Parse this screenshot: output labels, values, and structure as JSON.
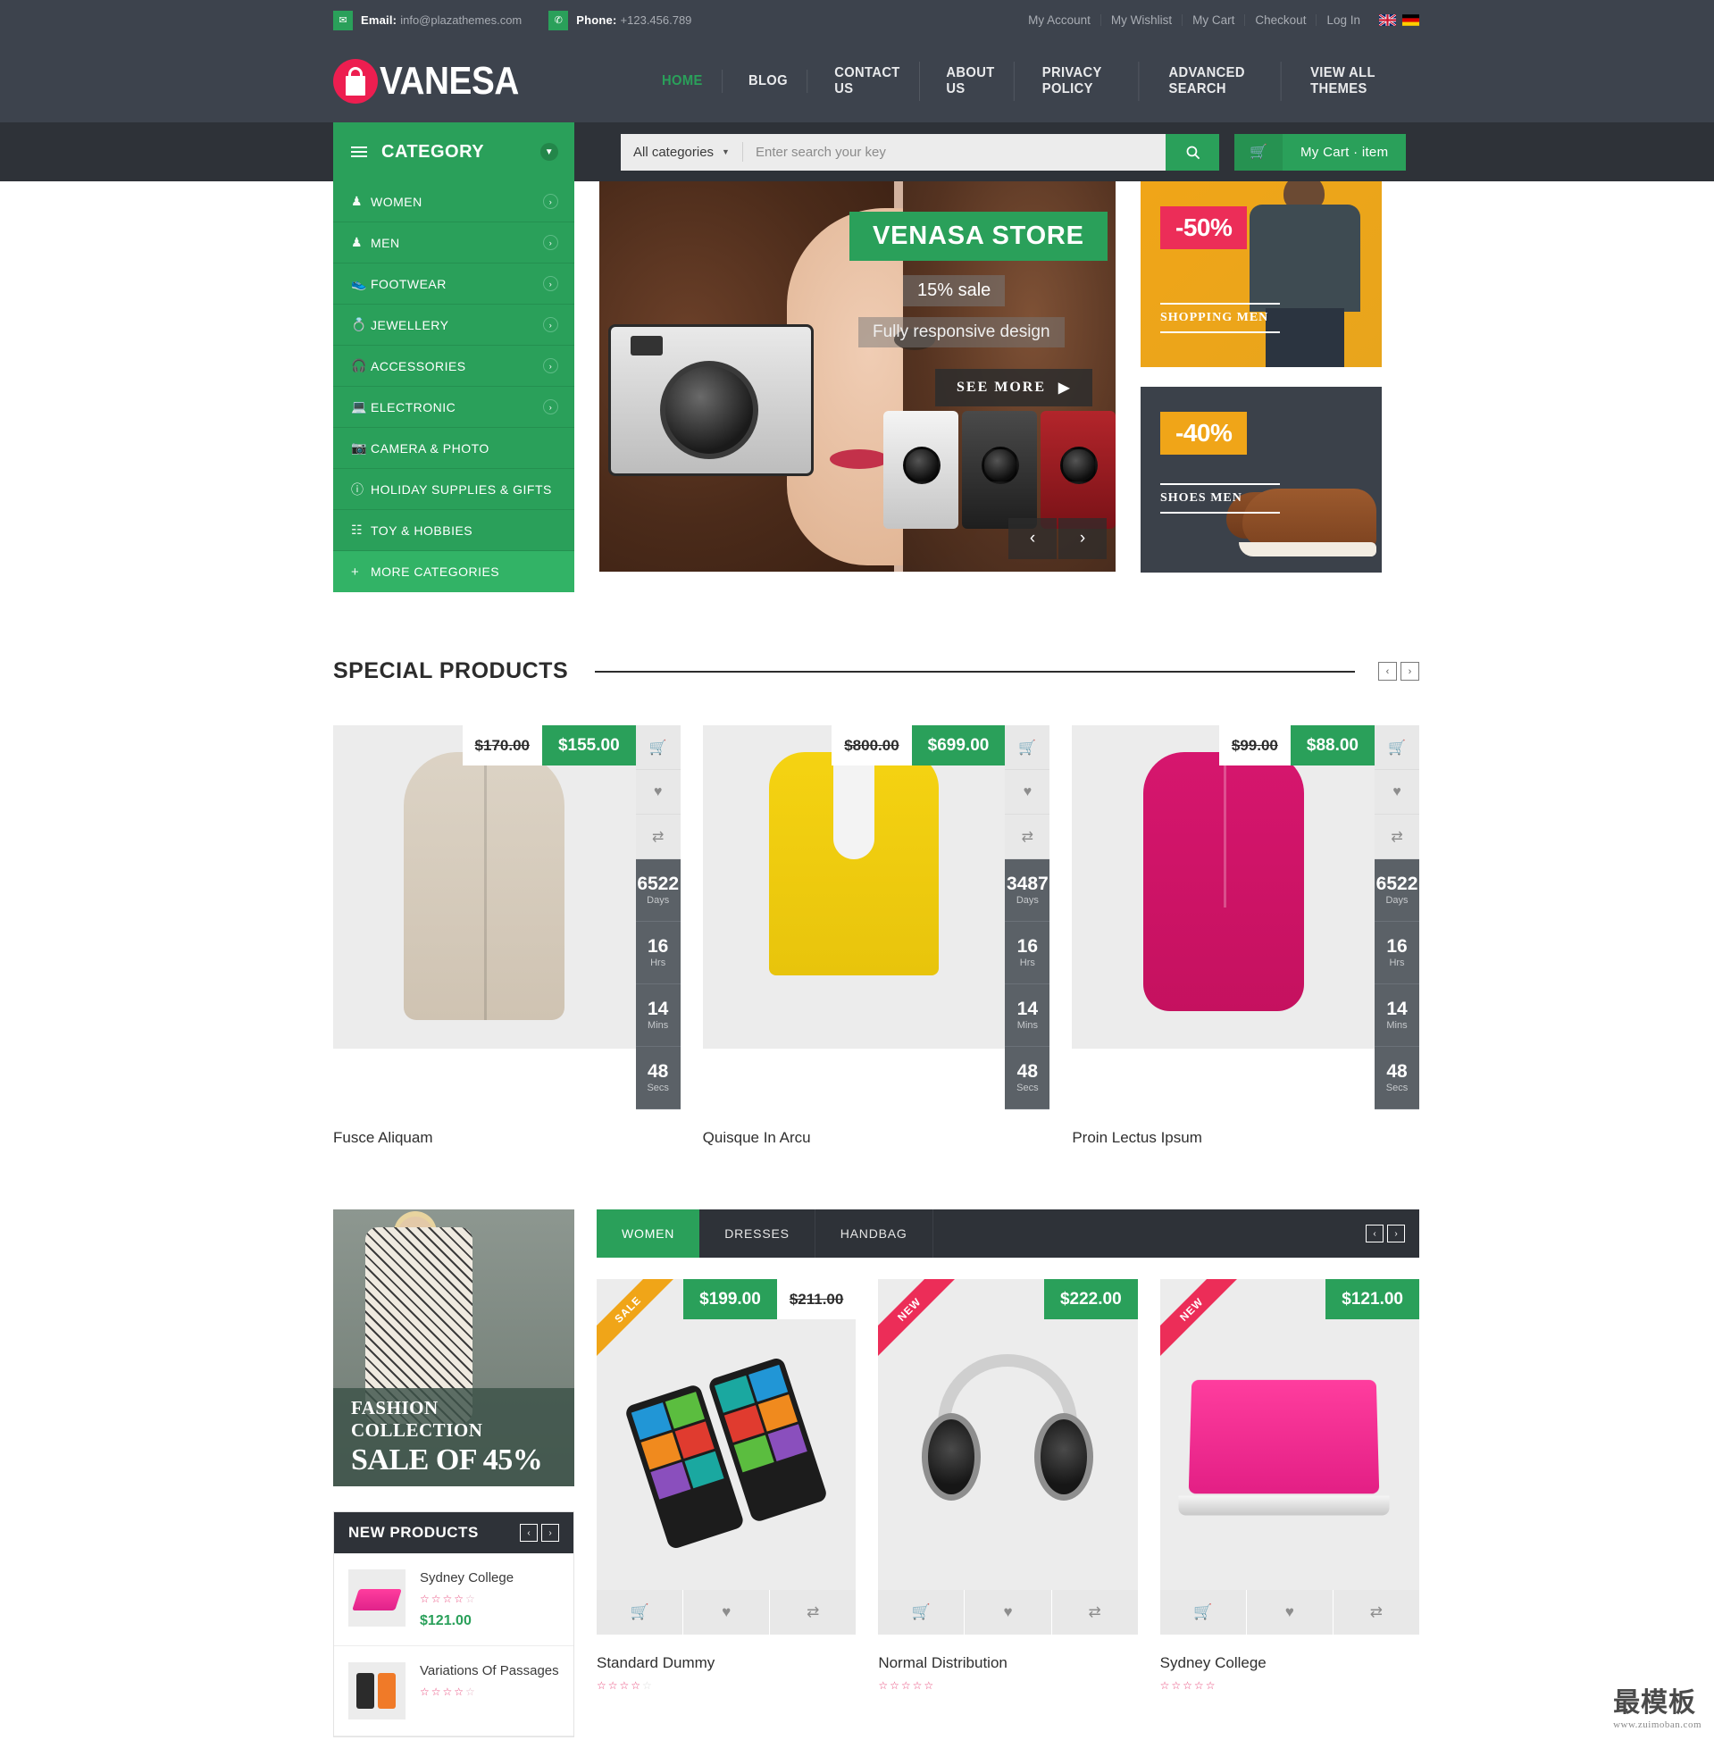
{
  "topbar": {
    "email_label": "Email:",
    "email_value": "info@plazathemes.com",
    "phone_label": "Phone:",
    "phone_value": "+123.456.789",
    "links": [
      {
        "label": "My Account"
      },
      {
        "label": "My Wishlist"
      },
      {
        "label": "My Cart"
      },
      {
        "label": "Checkout"
      },
      {
        "label": "Log In"
      }
    ],
    "flags": [
      "uk-flag-icon",
      "germany-flag-icon"
    ]
  },
  "header": {
    "logo_text": "VANESA",
    "logo_v": "V",
    "logo_rest": "ANESA",
    "nav": [
      {
        "label": "HOME",
        "active": true
      },
      {
        "label": "BLOG",
        "active": false
      },
      {
        "label": "CONTACT US",
        "active": false
      },
      {
        "label": "ABOUT US",
        "active": false
      },
      {
        "label": "PRIVACY POLICY",
        "active": false
      },
      {
        "label": "ADVANCED SEARCH",
        "active": false
      },
      {
        "label": "VIEW ALL THEMES",
        "active": false
      }
    ]
  },
  "search": {
    "category_button": "CATEGORY",
    "selected_category": "All categories",
    "placeholder": "Enter search your key",
    "value": "",
    "cart_label": "My Cart · item"
  },
  "categories": [
    {
      "label": "WOMEN",
      "icon": "women-icon",
      "has_arrow": true
    },
    {
      "label": "MEN",
      "icon": "men-icon",
      "has_arrow": true
    },
    {
      "label": "FOOTWEAR",
      "icon": "shoe-icon",
      "has_arrow": true
    },
    {
      "label": "JEWELLERY",
      "icon": "ring-icon",
      "has_arrow": true
    },
    {
      "label": "ACCESSORIES",
      "icon": "headphone-icon",
      "has_arrow": true
    },
    {
      "label": "ELECTRONIC",
      "icon": "laptop-icon",
      "has_arrow": true
    },
    {
      "label": "CAMERA & PHOTO",
      "icon": "camera-icon",
      "has_arrow": false
    },
    {
      "label": "HOLIDAY SUPPLIES & GIFTS",
      "icon": "gift-icon",
      "has_arrow": false
    },
    {
      "label": "TOY & HOBBIES",
      "icon": "toy-icon",
      "has_arrow": false
    },
    {
      "label": "MORE CATEGORIES",
      "icon": "plus-icon",
      "has_arrow": false
    }
  ],
  "slider": {
    "title": "VENASA STORE",
    "subtitle": "15% sale",
    "subtitle2": "Fully responsive design",
    "cta": "SEE MORE",
    "prev": "‹",
    "next": "›"
  },
  "promos": [
    {
      "discount": "-50%",
      "label": "SHOPPING MEN",
      "bg": "#f0a518",
      "bubble": "#ec2d58"
    },
    {
      "discount": "-40%",
      "label": "SHOES MEN",
      "bg": "#3b414a",
      "bubble": "#f0a518"
    }
  ],
  "special_products": {
    "heading": "SPECIAL PRODUCTS",
    "prev": "‹",
    "next": "›",
    "items": [
      {
        "name": "Fusce Aliquam",
        "old_price": "$170.00",
        "new_price": "$155.00",
        "countdown": [
          {
            "num": "6522",
            "unit": "Days"
          },
          {
            "num": "16",
            "unit": "Hrs"
          },
          {
            "num": "14",
            "unit": "Mins"
          },
          {
            "num": "48",
            "unit": "Secs"
          }
        ]
      },
      {
        "name": "Quisque In Arcu",
        "old_price": "$800.00",
        "new_price": "$699.00",
        "countdown": [
          {
            "num": "3487",
            "unit": "Days"
          },
          {
            "num": "16",
            "unit": "Hrs"
          },
          {
            "num": "14",
            "unit": "Mins"
          },
          {
            "num": "48",
            "unit": "Secs"
          }
        ]
      },
      {
        "name": "Proin Lectus Ipsum",
        "old_price": "$99.00",
        "new_price": "$88.00",
        "countdown": [
          {
            "num": "6522",
            "unit": "Days"
          },
          {
            "num": "16",
            "unit": "Hrs"
          },
          {
            "num": "14",
            "unit": "Mins"
          },
          {
            "num": "48",
            "unit": "Secs"
          }
        ]
      }
    ]
  },
  "fashion_banner": {
    "line1": "FASHION COLLECTION",
    "line2": "SALE OF 45%"
  },
  "new_products": {
    "title": "NEW PRODUCTS",
    "prev": "‹",
    "next": "›",
    "items": [
      {
        "name": "Sydney College",
        "price": "$121.00",
        "rating": 0,
        "thumb": "laptop-pink-thumb"
      },
      {
        "name": "Variations Of Passages",
        "price": "",
        "rating": 0,
        "thumb": "phones-thumb"
      }
    ]
  },
  "women_tabs": {
    "tabs": [
      {
        "label": "WOMEN",
        "active": true
      },
      {
        "label": "DRESSES",
        "active": false
      },
      {
        "label": "HANDBAG",
        "active": false
      }
    ],
    "prev": "‹",
    "next": "›"
  },
  "women_products": [
    {
      "name": "Standard Dummy",
      "badge": "SALE",
      "badge_type": "sale",
      "new_price": "$199.00",
      "old_price": "$211.00",
      "rating": 4,
      "image": "windows-phones"
    },
    {
      "name": "Normal Distribution",
      "badge": "NEW",
      "badge_type": "new",
      "new_price": "$222.00",
      "old_price": "",
      "rating": 5,
      "image": "headphones"
    },
    {
      "name": "Sydney College",
      "badge": "NEW",
      "badge_type": "new",
      "new_price": "$121.00",
      "old_price": "",
      "rating": 5,
      "image": "laptop-pink"
    }
  ],
  "product_actions": [
    "cart-icon",
    "heart-icon",
    "compare-icon"
  ],
  "watermark": {
    "text": "最模板",
    "sub": "www.zuimoban.com"
  },
  "colors": {
    "green": "#2aa05a",
    "dark": "#3d434d",
    "darker": "#2e3238",
    "pink": "#ec2d58",
    "orange": "#f0a518"
  }
}
